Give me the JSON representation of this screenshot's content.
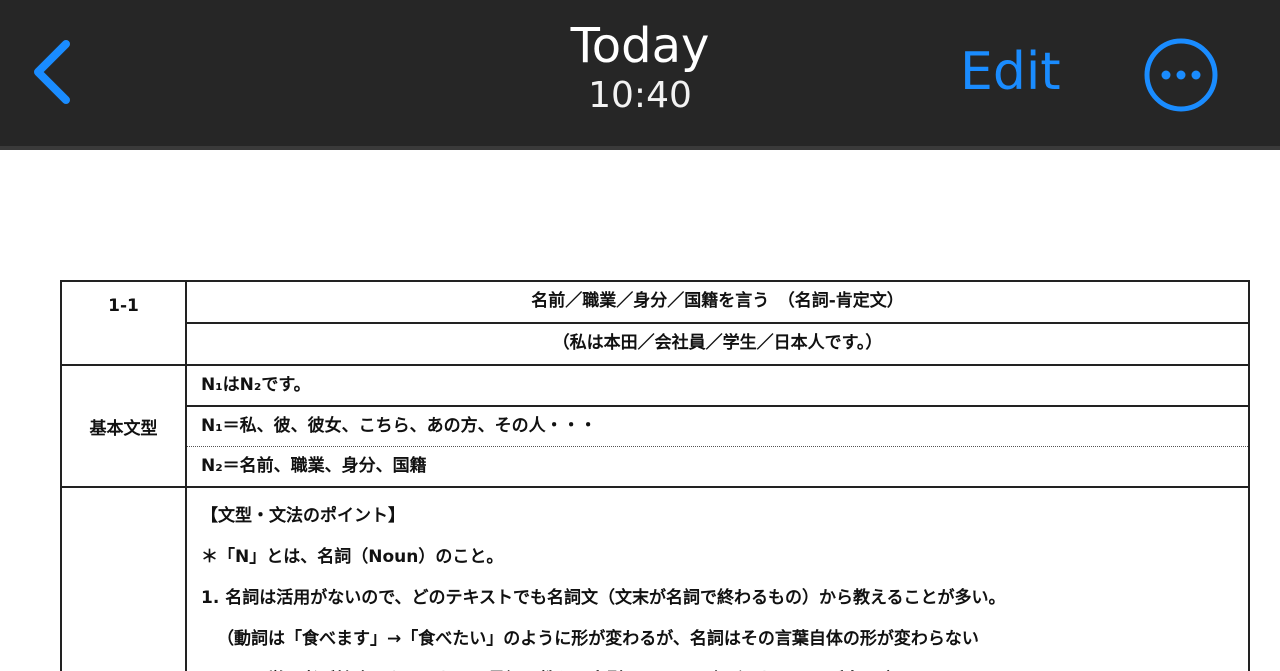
{
  "navbar": {
    "back_icon": "chevron-left-icon",
    "title": "Today",
    "subtitle": "10:40",
    "edit_label": "Edit",
    "more_icon": "ellipsis-circle-icon",
    "accent_color": "#1a8cff",
    "background_color": "#262626"
  },
  "document": {
    "lesson_id": "1-1",
    "lesson_title": "名前／職業／身分／国籍を言う　（名詞-肯定文）",
    "lesson_example": "（私は本田／会社員／学生／日本人です。）",
    "basic_pattern_label": "基本文型",
    "patterns": [
      "N₁はN₂です。",
      "N₁＝私、彼、彼女、こちら、あの方、その人・・・",
      "N₂＝名前、職業、身分、国籍"
    ],
    "points": [
      "【文型・文法のポイント】",
      "＊「N」とは、名詞（Noun）のこと。",
      "1. 名詞は活用がないので、どのテキストでも名詞文（文末が名詞で終わるもの）から教えることが多い。",
      "（動詞は「食べます」→「食べたい」のように形が変わるが、名詞はその言葉自体の形が変わらない",
      "ので、学習者が勉強しやすいため、最初に教える文型として取り上げられることが多い。）"
    ]
  }
}
